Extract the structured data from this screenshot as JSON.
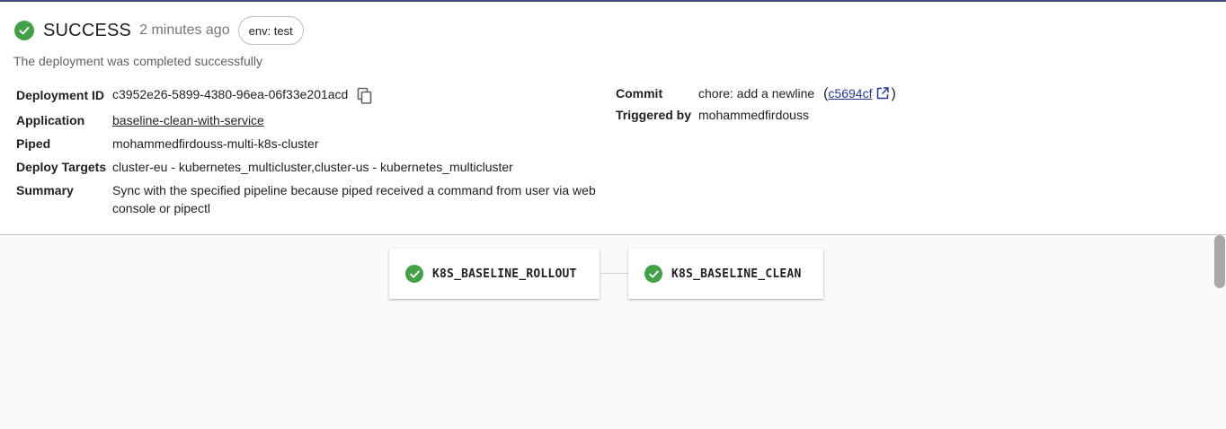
{
  "status": {
    "label": "SUCCESS",
    "time": "2 minutes ago",
    "env_chip": "env: test",
    "icon": "check-circle-icon",
    "color": "#43a047"
  },
  "description": "The deployment was completed successfully",
  "details": {
    "deployment_id": {
      "label": "Deployment ID",
      "value": "c3952e26-5899-4380-96ea-06f33e201acd"
    },
    "application": {
      "label": "Application",
      "value": "baseline-clean-with-service"
    },
    "piped": {
      "label": "Piped",
      "value": "mohammedfirdouss-multi-k8s-cluster"
    },
    "deploy_targets": {
      "label": "Deploy Targets",
      "value": "cluster-eu - kubernetes_multicluster,cluster-us - kubernetes_multicluster"
    },
    "summary": {
      "label": "Summary",
      "value": "Sync with the specified pipeline because piped received a command from user via web console or pipectl"
    },
    "commit": {
      "label": "Commit",
      "message": "chore: add a newline",
      "open_paren": "(",
      "hash": "c5694cf",
      "close_paren": ")"
    },
    "triggered_by": {
      "label": "Triggered by",
      "value": "mohammedfirdouss"
    }
  },
  "pipeline": {
    "stages": [
      {
        "name": "K8S_BASELINE_ROLLOUT",
        "status": "success"
      },
      {
        "name": "K8S_BASELINE_CLEAN",
        "status": "success"
      }
    ]
  },
  "colors": {
    "accent": "#3f4a7a",
    "link": "#283593",
    "success": "#43a047",
    "pipeline_bg": "#fafafa"
  }
}
